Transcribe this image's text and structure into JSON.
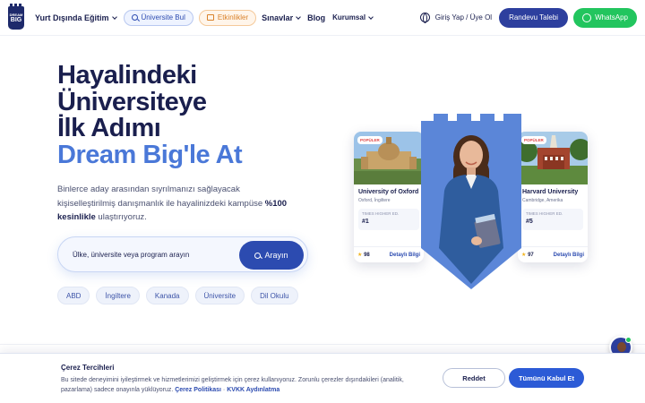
{
  "brand": {
    "logo_top": "DREAM",
    "logo_bottom": "BIG"
  },
  "nav": {
    "study_abroad": "Yurt Dışında Eğitim",
    "find_university": "Üniversite Bul",
    "events": "Etkinlikler",
    "exams": "Sınavlar",
    "blog": "Blog",
    "corporate": "Kurumsal",
    "login": "Giriş Yap / Üye Ol",
    "appointment": "Randevu Talebi",
    "whatsapp": "WhatsApp"
  },
  "hero": {
    "line1": "Hayalindeki",
    "line2": "Üniversiteye",
    "line3": "İlk Adımı",
    "line4": "Dream Big'le At",
    "desc_part1": "Binlerce aday arasından sıyrılmanızı sağlayacak kişiselleştirilmiş danışmanlık ile hayalinizdeki kampüse ",
    "desc_bold": "%100 kesinlikle",
    "desc_part2": " ulaştırıyoruz."
  },
  "search": {
    "placeholder": "Ülke, üniversite veya program arayın",
    "button": "Arayın"
  },
  "tags": [
    "ABD",
    "İngiltere",
    "Kanada",
    "Üniversite",
    "Dil Okulu"
  ],
  "cards": [
    {
      "badge": "POPÜLER",
      "name": "University of Oxford",
      "location": "Oxford, İngiltere",
      "rank_label": "TIMES HIGHER ED.",
      "rank_value": "#1",
      "score": "98",
      "details": "Detaylı Bilgi"
    },
    {
      "badge": "POPÜLER",
      "name": "Harvard University",
      "location": "Cambridge, Amerika",
      "rank_label": "TIMES HIGHER ED.",
      "rank_value": "#5",
      "score": "97",
      "details": "Detaylı Bilgi"
    }
  ],
  "cookie": {
    "title": "Çerez Tercihleri",
    "text": "Bu sitede deneyimini iyileştirmek ve hizmetlerimizi geliştirmek için çerez kullanıyoruz. Zorunlu çerezler dışındakileri (analitik, pazarlama) sadece onayınla yüklüyoruz. ",
    "policy_link": "Çerez Politikası",
    "separator": " · ",
    "kvkk_link": "KVKK Aydınlatma",
    "reject": "Reddet",
    "accept_all": "Tümünü Kabul Et"
  },
  "colors": {
    "navy": "#1a1f4e",
    "accent_blue": "#4a78d8",
    "primary_button": "#2c4bb0",
    "whatsapp_green": "#22c55e",
    "popular_red": "#e04848"
  },
  "icons": [
    "logo-icon",
    "search-icon",
    "calendar-icon",
    "globe-icon",
    "whatsapp-icon",
    "star-icon",
    "chevron-down-icon"
  ]
}
